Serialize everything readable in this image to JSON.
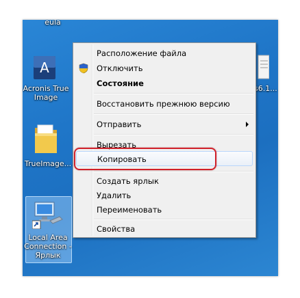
{
  "desktop": {
    "top_label": "eula",
    "icons": [
      {
        "id": "acronis",
        "label_line1": "Acronis True",
        "label_line2": "Image",
        "icon": "acronis-app-icon"
      },
      {
        "id": "trueimage",
        "label_line1": "TrueImage...",
        "icon": "folder-icon"
      },
      {
        "id": "lan",
        "label_line1": "Local Area",
        "label_line2": "Connection -",
        "label_line3": "Ярлык",
        "icon": "network-computer-icon"
      }
    ],
    "right_label": "s6.1..."
  },
  "context_menu": {
    "items": [
      {
        "label": "Расположение файла"
      },
      {
        "label": "Отключить",
        "icon": "uac-shield-icon"
      },
      {
        "label": "Состояние",
        "bold": true
      },
      {
        "label": "Восстановить прежнюю версию"
      },
      {
        "label": "Отправить",
        "submenu": true
      },
      {
        "label": "Вырезать"
      },
      {
        "label": "Копировать",
        "highlighted": true
      },
      {
        "label": "Создать ярлык"
      },
      {
        "label": "Удалить"
      },
      {
        "label": "Переименовать"
      },
      {
        "label": "Свойства"
      }
    ]
  },
  "colors": {
    "highlight_ring": "#d0202a",
    "desktop": "#1f76c8"
  }
}
